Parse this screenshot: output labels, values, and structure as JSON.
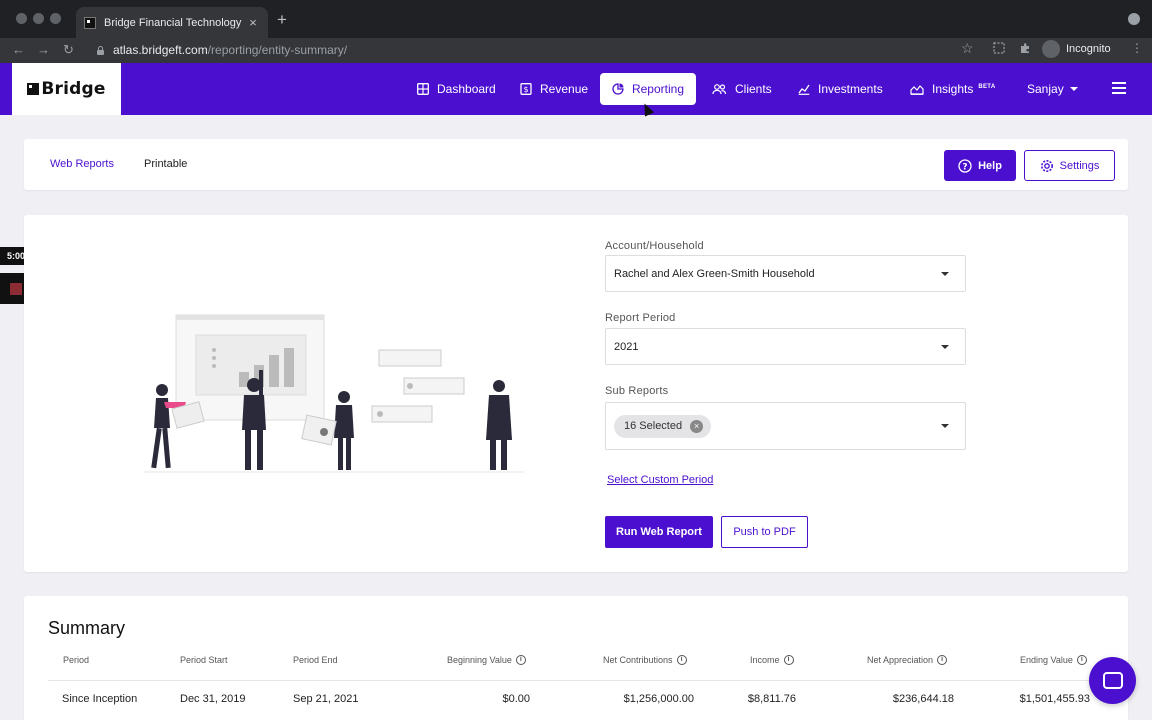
{
  "browser": {
    "tab_title": "Bridge Financial Technology",
    "tab_close": "×",
    "new_tab": "+",
    "url_host": "atlas.bridgeft.com",
    "url_path": "/reporting/entity-summary/",
    "profile_label": "Incognito",
    "back": "←",
    "forward": "→",
    "reload": "↻",
    "star": "☆",
    "menu": "⋮"
  },
  "nav": {
    "logo_text": "Bridge",
    "items": [
      {
        "label": "Dashboard",
        "icon": "grid-icon"
      },
      {
        "label": "Revenue",
        "icon": "dollar-icon"
      },
      {
        "label": "Reporting",
        "icon": "pie-chart-icon",
        "active": true
      },
      {
        "label": "Clients",
        "icon": "users-icon"
      },
      {
        "label": "Investments",
        "icon": "line-chart-icon"
      },
      {
        "label": "Insights",
        "icon": "area-chart-icon",
        "badge": "BETA"
      }
    ],
    "user_name": "Sanjay"
  },
  "subnav": {
    "tab_web_reports": "Web Reports",
    "tab_printable": "Printable",
    "help_label": "Help",
    "settings_label": "Settings"
  },
  "timer": {
    "value": "5:00"
  },
  "form": {
    "account_label": "Account/Household",
    "account_value": "Rachel and Alex Green-Smith Household",
    "period_label": "Report Period",
    "period_value": "2021",
    "sub_reports_label": "Sub Reports",
    "sub_reports_chip": "16 Selected",
    "custom_period_link": "Select Custom Period",
    "run_button": "Run Web Report",
    "pdf_button": "Push to PDF"
  },
  "summary": {
    "title": "Summary",
    "columns": [
      "Period",
      "Period Start",
      "Period End",
      "Beginning Value",
      "Net Contributions",
      "Income",
      "Net Appreciation",
      "Ending Value"
    ],
    "rows": [
      [
        "Since Inception",
        "Dec 31, 2019",
        "Sep 21, 2021",
        "$0.00",
        "$1,256,000.00",
        "$8,811.76",
        "$236,644.18",
        "$1,501,455.93"
      ]
    ]
  },
  "colors": {
    "brand": "#4b0fcf",
    "page_bg": "#f0f0f4"
  }
}
